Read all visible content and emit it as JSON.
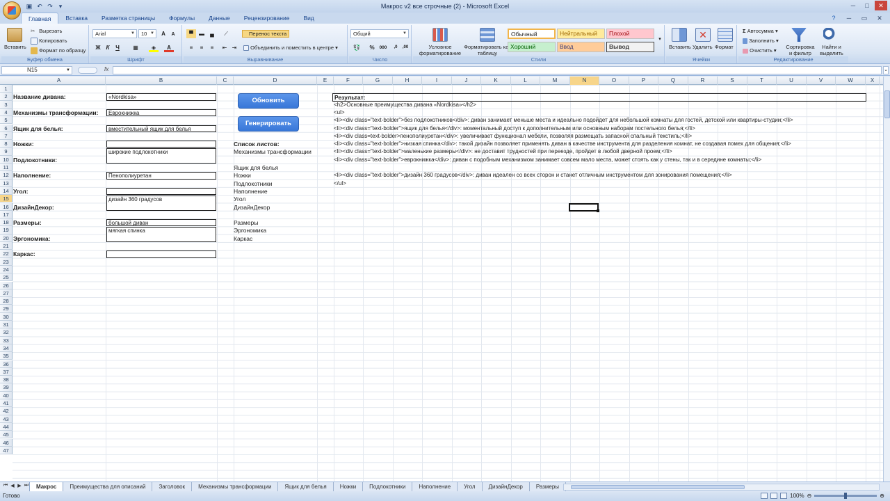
{
  "window": {
    "title": "Макрос v2 все строчные (2) - Microsoft Excel"
  },
  "ribbon_tabs": [
    "Главная",
    "Вставка",
    "Разметка страницы",
    "Формулы",
    "Данные",
    "Рецензирование",
    "Вид"
  ],
  "ribbon": {
    "clipboard": {
      "paste": "Вставить",
      "cut": "Вырезать",
      "copy": "Копировать",
      "format_painter": "Формат по образцу",
      "label": "Буфер обмена"
    },
    "font": {
      "name": "Arial",
      "size": "10",
      "bold": "Ж",
      "italic": "К",
      "underline": "Ч",
      "label": "Шрифт"
    },
    "alignment": {
      "wrap": "Перенос текста",
      "merge": "Объединить и поместить в центре",
      "label": "Выравнивание"
    },
    "number": {
      "format": "Общий",
      "percent": "%",
      "thousands": "000",
      "label": "Число"
    },
    "styles": {
      "conditional": "Условное форматирование",
      "as_table": "Форматировать как таблицу",
      "normal": "Обычный",
      "neutral": "Нейтральный",
      "bad": "Плохой",
      "good": "Хороший",
      "input": "Ввод",
      "output": "Вывод",
      "label": "Стили"
    },
    "cells": {
      "insert": "Вставить",
      "delete": "Удалить",
      "format": "Формат",
      "label": "Ячейки"
    },
    "editing": {
      "autosum": "Автосумма",
      "fill": "Заполнить",
      "clear": "Очистить",
      "sort": "Сортировка и фильтр",
      "find": "Найти и выделить",
      "label": "Редактирование"
    }
  },
  "formula_bar": {
    "name_box": "N15",
    "fx": "fx",
    "content": ""
  },
  "columns": [
    "A",
    "B",
    "C",
    "D",
    "E",
    "F",
    "G",
    "H",
    "I",
    "J",
    "K",
    "L",
    "M",
    "N",
    "O",
    "P",
    "Q",
    "R",
    "S",
    "T",
    "U",
    "V",
    "W",
    "X"
  ],
  "selected_column": "N",
  "selected_row": 15,
  "row_count": 47,
  "form": [
    {
      "label": "Название дивана:",
      "value": "«Nordkisa»"
    },
    {
      "label": "Механизмы трансформации:",
      "value": "Еврокнижка"
    },
    {
      "label": "Ящик для белья:",
      "value": "вместительный ящик для белья"
    },
    {
      "label": "Ножки:",
      "value": ""
    },
    {
      "label": "Подлокотники:",
      "value": "широкие подлокотники"
    },
    {
      "label": "Наполнение:",
      "value": "Пенополиуретан"
    },
    {
      "label": "Угол:",
      "value": ""
    },
    {
      "label": "ДизайнДекор:",
      "value": "дизайн 360 градусов"
    },
    {
      "label": "Размеры:",
      "value": "большой диван"
    },
    {
      "label": "Эргономика:",
      "value": "мягкая спинка"
    },
    {
      "label": "Каркас:",
      "value": ""
    }
  ],
  "buttons": {
    "refresh": "Обновить",
    "generate": "Генерировать"
  },
  "sheet_list": {
    "title": "Список листов:",
    "items": [
      "Механизмы трансформации",
      "Ящик для белья",
      "Ножки",
      "Подлокотники",
      "Наполнение",
      "Угол",
      "ДизайнДекор",
      "Размеры",
      "Эргономика",
      "Каркас"
    ]
  },
  "result": {
    "title": "Результат:",
    "lines": [
      "<h2>Основные преимущества дивана «Nordkisa»</h2>",
      "<ul>",
      "<li><div class=\"text-bolder\">без подлокотников</div>: диван занимает меньше места и идеально подойдет для небольшой комнаты для гостей, детской или квартиры-студии;</li>",
      "<li><div class=\"text-bolder\">ящик для белья</div>: моментальный доступ к дополнительным или основным наборам постельного белья;</li>",
      "<li><div class=text-bolder>пенополиуретан</div>: увеличивает функционал мебели, позволяя размещать запасной спальный текстиль;</li>",
      "<li><div class=\"text-bolder\">низкая спинка</div>: такой дизайн позволяет применять диван в качестве инструмента для разделения комнат, не создавая помех для общения;</li>",
      "<li><div class=\"text-bolder\">маленькие размеры</div>: не доставит трудностей при переезде, пройдет в любой дверной проем;</li>",
      "<li><div class=\"text-bolder\">еврокнижка</div>: диван с подобным механизмом занимает совсем мало места, может стоять как у стены, так и в середине комнаты;</li>",
      "",
      "<li><div class=\"text-bolder\">дизайн 360 градусов</div>: диван идеален со всех сторон и станет отличным инструментом для зонирования помещения;</li>",
      "</ul>"
    ]
  },
  "sheet_tabs": [
    "Макрос",
    "Преимущества для описаний",
    "Заголовок",
    "Механизмы трансформации",
    "Ящик для белья",
    "Ножки",
    "Подлокотники",
    "Наполнение",
    "Угол",
    "ДизайнДекор",
    "Размеры"
  ],
  "active_sheet": "Макрос",
  "status": {
    "text": "Готово",
    "zoom": "100%"
  }
}
